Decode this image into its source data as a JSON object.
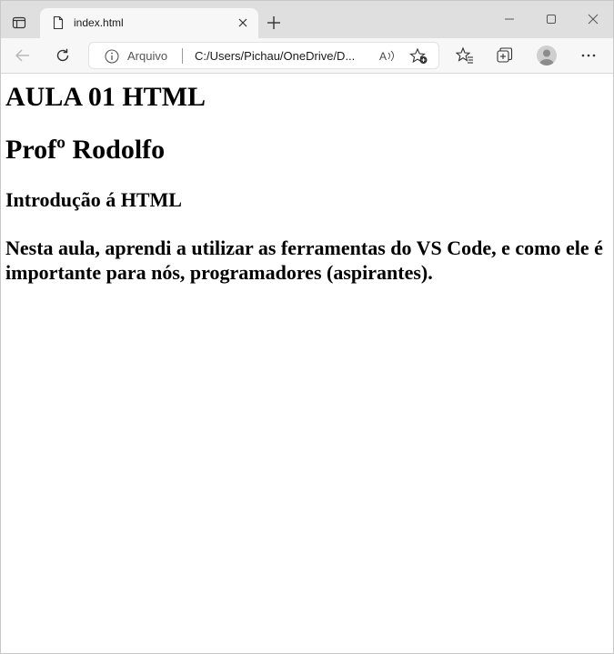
{
  "browser": {
    "tab": {
      "title": "index.html"
    },
    "address": {
      "security_label": "Arquivo",
      "url": "C:/Users/Pichau/OneDrive/D..."
    },
    "icons": {
      "tab_actions": "tab-actions-icon",
      "favicon": "document-icon",
      "close_tab": "close-icon",
      "new_tab": "plus-icon",
      "back": "arrow-left-icon",
      "refresh": "refresh-icon",
      "info": "info-icon",
      "read_aloud": "read-aloud-icon",
      "add_favorite": "star-add-icon",
      "favorites": "favorites-icon",
      "collections": "collections-icon",
      "profile": "profile-icon",
      "more": "more-icon"
    }
  },
  "page": {
    "heading1": "AULA 01 HTML",
    "heading2": "Profº Rodolfo",
    "heading3": "Introdução á HTML",
    "paragraph": "Nesta aula, aprendi a utilizar as ferramentas do VS Code, e como ele é importante para nós, programadores (aspirantes)."
  }
}
